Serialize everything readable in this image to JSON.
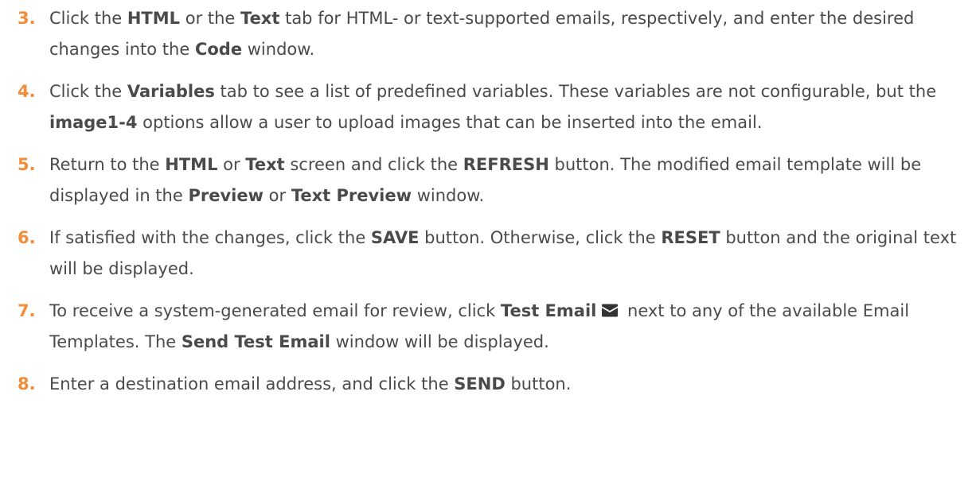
{
  "steps": [
    {
      "number": "3.",
      "parts": [
        {
          "t": "Click the ",
          "b": false
        },
        {
          "t": "HTML",
          "b": true
        },
        {
          "t": " or the ",
          "b": false
        },
        {
          "t": "Text",
          "b": true
        },
        {
          "t": " tab for HTML- or text-supported emails, respectively, and enter the desired changes into the ",
          "b": false
        },
        {
          "t": "Code",
          "b": true
        },
        {
          "t": " window.",
          "b": false
        }
      ]
    },
    {
      "number": "4.",
      "parts": [
        {
          "t": "Click the ",
          "b": false
        },
        {
          "t": "Variables",
          "b": true
        },
        {
          "t": " tab to see a list of predefined variables. These variables are not configurable, but the ",
          "b": false
        },
        {
          "t": "image1-4",
          "b": true
        },
        {
          "t": " options allow a user to upload images that can be inserted into the email.",
          "b": false
        }
      ]
    },
    {
      "number": "5.",
      "parts": [
        {
          "t": "Return to the ",
          "b": false
        },
        {
          "t": "HTML",
          "b": true
        },
        {
          "t": " or ",
          "b": false
        },
        {
          "t": "Text",
          "b": true
        },
        {
          "t": " screen and click the ",
          "b": false
        },
        {
          "t": "REFRESH",
          "b": true
        },
        {
          "t": " button. The modified email template will be displayed in the ",
          "b": false
        },
        {
          "t": "Preview",
          "b": true
        },
        {
          "t": " or ",
          "b": false
        },
        {
          "t": "Text Preview",
          "b": true
        },
        {
          "t": " window.",
          "b": false
        }
      ]
    },
    {
      "number": "6.",
      "parts": [
        {
          "t": "If satisfied with the changes, click the ",
          "b": false
        },
        {
          "t": "SAVE",
          "b": true
        },
        {
          "t": " button. Otherwise, click the ",
          "b": false
        },
        {
          "t": "RESET",
          "b": true
        },
        {
          "t": " button and the original text will be displayed.",
          "b": false
        }
      ]
    },
    {
      "number": "7.",
      "parts": [
        {
          "t": "To receive a system-generated email for review, click ",
          "b": false
        },
        {
          "t": "Test Email",
          "b": true
        },
        {
          "icon": "envelope-icon"
        },
        {
          "t": " next to any of the available Email Templates. The ",
          "b": false
        },
        {
          "t": "Send Test Email",
          "b": true
        },
        {
          "t": " window will be displayed.",
          "b": false
        }
      ]
    },
    {
      "number": "8.",
      "parts": [
        {
          "t": "Enter a destination email address, and click the ",
          "b": false
        },
        {
          "t": "SEND",
          "b": true
        },
        {
          "t": " button.",
          "b": false
        }
      ]
    }
  ],
  "colors": {
    "step_number": "#f08c3a",
    "text": "#4a4a4a"
  }
}
